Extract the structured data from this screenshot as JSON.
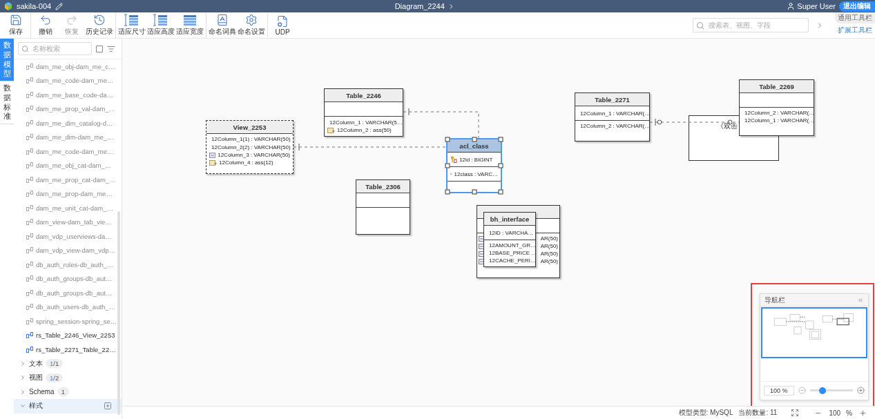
{
  "header": {
    "project": "sakila-004",
    "diagram": "Diagram_2244",
    "user": "Super User",
    "exit_button": "退出编辑"
  },
  "toolbar": {
    "groups": [
      {
        "buttons": [
          {
            "label": "保存",
            "disabled": false
          }
        ]
      },
      {
        "buttons": [
          {
            "label": "撤销",
            "disabled": false
          },
          {
            "label": "恢复",
            "disabled": true
          },
          {
            "label": "历史记录",
            "disabled": false
          }
        ]
      },
      {
        "buttons": [
          {
            "label": "适应尺寸",
            "disabled": false
          },
          {
            "label": "适应高度",
            "disabled": false
          },
          {
            "label": "适应宽度",
            "disabled": false
          }
        ]
      },
      {
        "buttons": [
          {
            "label": "命名词典",
            "disabled": false
          },
          {
            "label": "命名设置",
            "disabled": false
          }
        ]
      },
      {
        "buttons": [
          {
            "label": "UDP",
            "disabled": false
          }
        ]
      }
    ],
    "search": {
      "placeholder": "搜索表、视图、字段"
    },
    "tabs": [
      {
        "label": "通用工具栏",
        "selected": true
      },
      {
        "label": "扩展工具栏",
        "selected": false
      }
    ]
  },
  "side_tabs": [
    {
      "label": "数据模型",
      "selected": true
    },
    {
      "label": "数据标准",
      "selected": false
    }
  ],
  "sidebar": {
    "search": {
      "placeholder": "名称检索"
    },
    "select_all": {
      "checked": false
    },
    "items": [
      {
        "label": "dam_me_obj-dam_me_c…",
        "active": false
      },
      {
        "label": "dam_me_code-dam_me…",
        "active": false
      },
      {
        "label": "dam_me_base_code-da…",
        "active": false
      },
      {
        "label": "dam_me_prop_val-dam_…",
        "active": false
      },
      {
        "label": "dam_me_dim_catalog-d…",
        "active": false
      },
      {
        "label": "dam_me_dim-dam_me_…",
        "active": false
      },
      {
        "label": "dam_me_code-dam_me…",
        "active": false
      },
      {
        "label": "dam_me_obj_cat-dam_…",
        "active": false
      },
      {
        "label": "dam_me_prop_cat-dam_…",
        "active": false
      },
      {
        "label": "dam_me_prop-dam_me…",
        "active": false
      },
      {
        "label": "dam_me_unit_cat-dam_…",
        "active": false
      },
      {
        "label": "dam_view-dam_tab_vie…",
        "active": false
      },
      {
        "label": "dam_vdp_userviews-da…",
        "active": false
      },
      {
        "label": "dam_vdp_view-dam_vdp…",
        "active": false
      },
      {
        "label": "db_auth_roles-db_auth_…",
        "active": false
      },
      {
        "label": "db_auth_groups-db_aut…",
        "active": false
      },
      {
        "label": "db_auth_groups-db_aut…",
        "active": false
      },
      {
        "label": "db_auth_users-db_auth_…",
        "active": false
      },
      {
        "label": "spring_session-spring_se…",
        "active": false
      },
      {
        "label": "rs_Table_2246_View_2253",
        "active": true
      },
      {
        "label": "rs_Table_2271_Table_22…",
        "active": true
      }
    ],
    "groups": [
      {
        "label": "文本",
        "expanded": false,
        "badge": [
          {
            "text": "1",
            "highlight": true
          },
          {
            "text": "/1",
            "highlight": false
          }
        ]
      },
      {
        "label": "视图",
        "expanded": false,
        "badge": [
          {
            "text": "1",
            "highlight": true
          },
          {
            "text": "/2",
            "highlight": false
          }
        ]
      },
      {
        "label": "Schema",
        "expanded": false,
        "badge": [
          {
            "text": "1",
            "highlight": false
          }
        ]
      },
      {
        "label": "样式",
        "expanded": true
      }
    ]
  },
  "canvas": {
    "entities": [
      {
        "kind": "view",
        "name": "View_2253",
        "selected": false,
        "columns": [
          {
            "kind": "column",
            "text": "12Column_1(1) : VARCHAR(50)"
          },
          {
            "kind": "foreign-key",
            "text": "12Column_2(2) : VARCHAR(50)"
          },
          {
            "kind": "column",
            "text": "12Column_3 : VARCHAR(50)"
          },
          {
            "kind": "computed",
            "text": "12Column_4 : ass(12)"
          }
        ]
      },
      {
        "kind": "table",
        "name": "Table_2246",
        "selected": false,
        "columns": [
          {
            "kind": "foreign-key",
            "text": "12Column_1 : VARCHAR(5…"
          },
          {
            "kind": "computed",
            "text": "12Column_2 : ass(50)"
          }
        ]
      },
      {
        "kind": "table",
        "name": "acl_class",
        "selected": true,
        "keys": [
          {
            "kind": "primary-key",
            "text": "12id : BIGINT"
          }
        ],
        "columns": [
          {
            "kind": "column",
            "text": "12class : VARC…"
          }
        ]
      },
      {
        "kind": "table",
        "name": "Table_2306",
        "selected": false
      },
      {
        "kind": "table",
        "name": "bh_interface",
        "selected": false,
        "keys": [
          {
            "kind": "primary-key",
            "text": "12ID : VARCHA…"
          }
        ],
        "columns": [
          {
            "kind": "column",
            "text": "12AMOUNT_GR…"
          },
          {
            "kind": "column",
            "text": "12BASE_PRICE …"
          },
          {
            "kind": "column",
            "text": "12CACHE_PERI…"
          }
        ]
      },
      {
        "kind": "table",
        "selected": false,
        "columns": [
          {
            "kind": "column",
            "text": "AR(50)"
          },
          {
            "kind": "column",
            "text": "AR(50)"
          },
          {
            "kind": "column",
            "text": "AR(50)"
          },
          {
            "kind": "column",
            "text": "AR(50)"
          }
        ]
      },
      {
        "kind": "table",
        "name": "Table_2271",
        "selected": false,
        "keys": [
          {
            "kind": "primary-key",
            "text": "12Column_1 : VARCHAR(…"
          }
        ],
        "columns": [
          {
            "kind": "column",
            "text": "12Column_2 : VARCHAR(…"
          }
        ]
      },
      {
        "kind": "note",
        "text": "《双击"
      },
      {
        "kind": "table",
        "name": "Table_2269",
        "selected": false,
        "columns": [
          {
            "kind": "column",
            "text": "12Column_2 : VARCHAR(…"
          },
          {
            "kind": "column",
            "text": "12Column_1 : VARCHAR(…"
          }
        ]
      }
    ]
  },
  "navigator": {
    "title": "导航栏",
    "zoom": "100 %",
    "zoom_slider": {
      "level": 0.3
    }
  },
  "status_bar": {
    "model_type": "模型类型: MySQL",
    "count": "当前数量: 11",
    "zoom": "100",
    "zoom_unit": "%"
  }
}
